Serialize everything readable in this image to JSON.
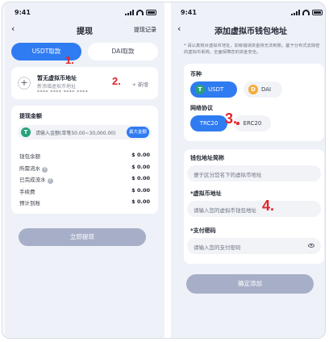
{
  "status": {
    "time": "9:41"
  },
  "withdraw": {
    "title": "提现",
    "record_link": "提现记录",
    "back": "‹",
    "tabs": [
      {
        "label": "USDT取款"
      },
      {
        "label": "DAI取款"
      }
    ],
    "address": {
      "title": "暂无虚拟币地址",
      "subtitle": "新添增虚拟币地址",
      "masked": "**** **** **** ****",
      "new_label": "+ 新增"
    },
    "amount": {
      "section_title": "提现金额",
      "placeholder": "请输入金额(单笔50.00~30,000.00)",
      "max_label": "最大金额"
    },
    "rows": [
      {
        "label": "钱包余额",
        "value": "$ 0.00",
        "info": false
      },
      {
        "label": "所需流水",
        "value": "$ 0.00",
        "info": true
      },
      {
        "label": "已完成流水",
        "value": "$ 0.00",
        "info": true
      },
      {
        "label": "手续费",
        "value": "$ 0.00",
        "info": false
      },
      {
        "label": "预计到账",
        "value": "$ 0.00",
        "info": false
      }
    ],
    "submit_label": "立即提现"
  },
  "add_address": {
    "title": "添加虚拟币钱包地址",
    "back": "‹",
    "notice": "* 请认真核对虚拟币地址，如有错误资金将无法到账。基于分布式去除密的虚拟币系统，全面保障您的资金安全。",
    "currency_label": "币种",
    "currencies": [
      {
        "label": "USDT",
        "icon": "tether-icon"
      },
      {
        "label": "DAI",
        "icon": "dai-icon"
      }
    ],
    "network_label": "网络协议",
    "networks": [
      {
        "label": "TRC20"
      },
      {
        "label": "ERC20"
      }
    ],
    "alias_label": "钱包地址简称",
    "alias_placeholder": "便于区分您名下的虚拟币地址",
    "address_label": "*虚拟币地址",
    "address_placeholder": "请输入您的虚拟币钱包地址",
    "password_label": "*支付密码",
    "password_placeholder": "请输入您的支付密码",
    "submit_label": "确定添加"
  },
  "markers": [
    "1.",
    "2.",
    "3.",
    "4."
  ],
  "icons": {
    "usdt_symbol": "T",
    "dai_symbol": "D",
    "plus": "+",
    "info": "?"
  },
  "colors": {
    "accent": "#2f7bf1",
    "tether": "#26a17b",
    "dai": "#f5ac37",
    "marker": "#e3242b",
    "disabled_button": "#a7afc8"
  }
}
